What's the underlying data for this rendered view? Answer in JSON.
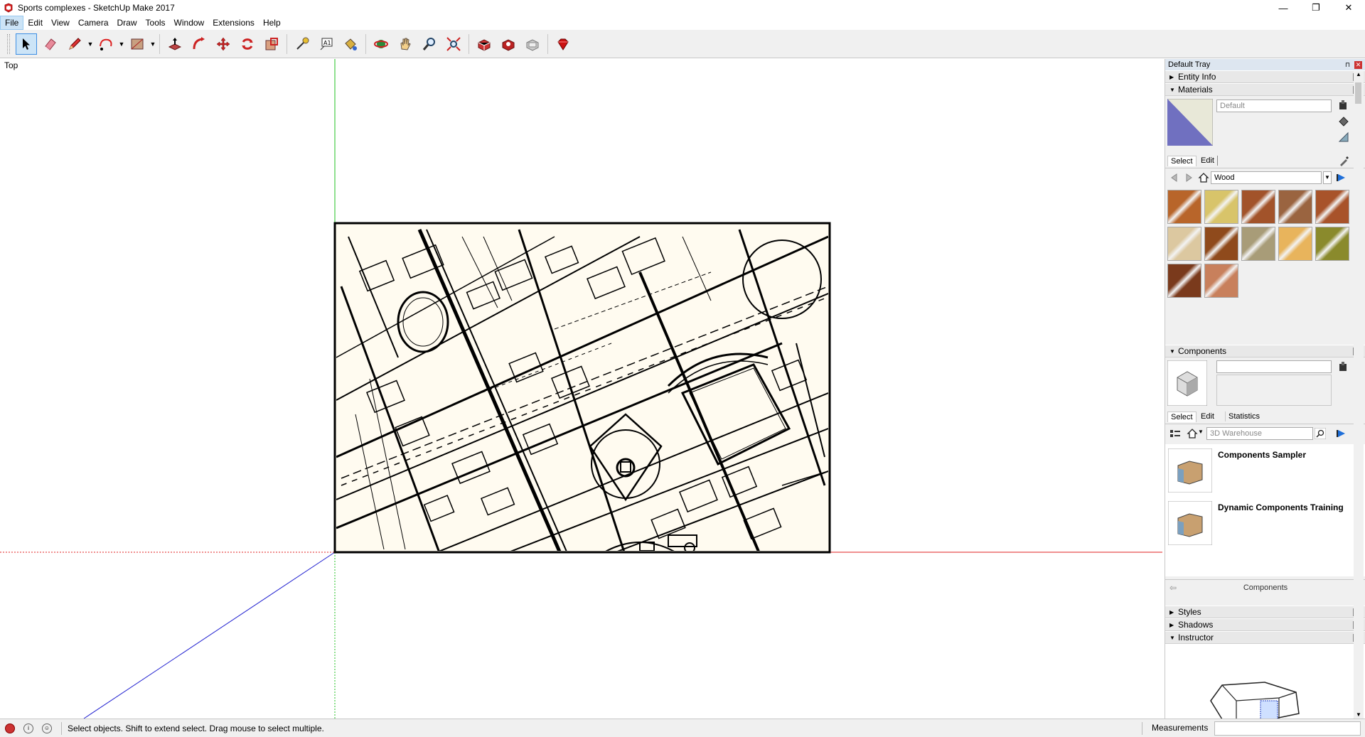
{
  "window": {
    "title": "Sports complexes - SketchUp Make 2017",
    "controls": {
      "minimize": "—",
      "restore": "❐",
      "close": "✕"
    }
  },
  "menu": [
    {
      "label": "File",
      "active": true
    },
    {
      "label": "Edit"
    },
    {
      "label": "View"
    },
    {
      "label": "Camera"
    },
    {
      "label": "Draw"
    },
    {
      "label": "Tools"
    },
    {
      "label": "Window"
    },
    {
      "label": "Extensions"
    },
    {
      "label": "Help"
    }
  ],
  "toolbar": {
    "tools": [
      "select-icon",
      "eraser-icon",
      "pencil-icon",
      "arc-icon",
      "rectangle-icon",
      "push-pull-icon",
      "follow-me-icon",
      "move-icon",
      "rotate-icon",
      "scale-icon",
      "tape-measure-icon",
      "text-icon",
      "paint-bucket-icon",
      "orbit-icon",
      "pan-icon",
      "zoom-icon",
      "zoom-extents-icon",
      "warehouse-icon",
      "extension-warehouse-icon",
      "layout-icon",
      "ruby-icon"
    ]
  },
  "viewport": {
    "view_label": "Top"
  },
  "tray": {
    "title": "Default Tray",
    "pin": "⊓",
    "close": "✕",
    "entity_info": {
      "label": "Entity Info",
      "expanded": false
    },
    "materials": {
      "label": "Materials",
      "expanded": true,
      "current_material": "Default",
      "tabs": [
        "Select",
        "Edit"
      ],
      "active_tab": "Select",
      "library": "Wood",
      "swatch_colors": [
        "#b8652a",
        "#d8c46a",
        "#a2532a",
        "#9a6440",
        "#a8532a",
        "#dcc8a0",
        "#8f4a1c",
        "#a89c78",
        "#e8b45c",
        "#8a8a2c",
        "#7a3a1c",
        "#c8805c"
      ]
    },
    "components": {
      "label": "Components",
      "expanded": true,
      "tabs": [
        "Select",
        "Edit",
        "Statistics"
      ],
      "active_tab": "Select",
      "search_placeholder": "3D Warehouse",
      "items": [
        {
          "name": "Components Sampler"
        },
        {
          "name": "Dynamic Components Training"
        }
      ],
      "footer": "Components"
    },
    "styles": {
      "label": "Styles",
      "expanded": false
    },
    "shadows": {
      "label": "Shadows",
      "expanded": false
    },
    "instructor": {
      "label": "Instructor",
      "expanded": true
    }
  },
  "status": {
    "message": "Select objects. Shift to extend select. Drag mouse to select multiple.",
    "measurements_label": "Measurements",
    "measurements_value": ""
  },
  "colors": {
    "axis_red": "#e02020",
    "axis_green": "#20c020",
    "axis_blue": "#2020d0",
    "map_fill": "#fffbf0",
    "selection": "#cce4f7"
  }
}
